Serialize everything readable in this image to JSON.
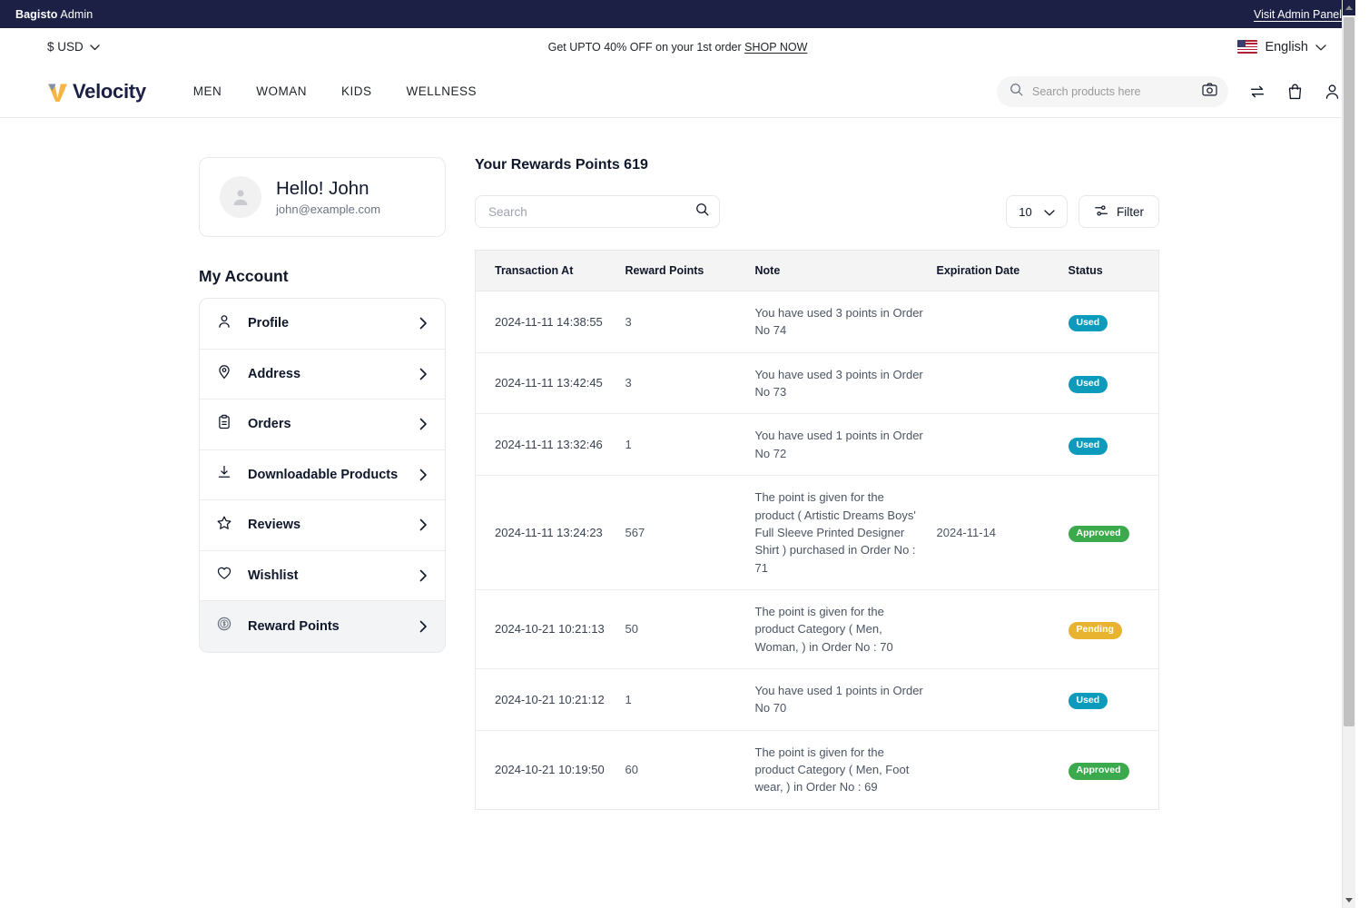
{
  "admin_bar": {
    "brand_bold": "Bagisto",
    "brand_rest": " Admin",
    "visit_link": "Visit Admin Panel"
  },
  "promo_bar": {
    "currency": "$ USD",
    "promo_text": "Get UPTO 40% OFF on your 1st order ",
    "promo_cta": "SHOP NOW",
    "language": "English"
  },
  "header": {
    "logo_text": "Velocity",
    "nav": [
      {
        "label": "MEN"
      },
      {
        "label": "WOMAN"
      },
      {
        "label": "KIDS"
      },
      {
        "label": "WELLNESS"
      }
    ],
    "search_placeholder": "Search products here",
    "search_value": ""
  },
  "sidebar": {
    "greeting": "Hello! John",
    "email": "john@example.com",
    "account_title": "My Account",
    "items": [
      {
        "label": "Profile",
        "icon": "user-icon",
        "active": false
      },
      {
        "label": "Address",
        "icon": "location-icon",
        "active": false
      },
      {
        "label": "Orders",
        "icon": "clipboard-icon",
        "active": false
      },
      {
        "label": "Downloadable Products",
        "icon": "download-icon",
        "active": false
      },
      {
        "label": "Reviews",
        "icon": "star-icon",
        "active": false
      },
      {
        "label": "Wishlist",
        "icon": "heart-icon",
        "active": false
      },
      {
        "label": "Reward Points",
        "icon": "coin-icon",
        "active": true
      }
    ]
  },
  "main": {
    "title": "Your Rewards Points 619",
    "rewards_points": 619,
    "search_placeholder": "Search",
    "search_value": "",
    "per_page": "10",
    "filter_label": "Filter",
    "columns": [
      "Transaction At",
      "Reward Points",
      "Note",
      "Expiration Date",
      "Status"
    ],
    "rows": [
      {
        "transaction_at": "2024-11-11 14:38:55",
        "reward_points": "3",
        "note": "You have used 3 points in Order No 74",
        "expiration_date": "",
        "status": "Used",
        "status_kind": "used"
      },
      {
        "transaction_at": "2024-11-11 13:42:45",
        "reward_points": "3",
        "note": "You have used 3 points in Order No 73",
        "expiration_date": "",
        "status": "Used",
        "status_kind": "used"
      },
      {
        "transaction_at": "2024-11-11 13:32:46",
        "reward_points": "1",
        "note": "You have used 1 points in Order No 72",
        "expiration_date": "",
        "status": "Used",
        "status_kind": "used"
      },
      {
        "transaction_at": "2024-11-11 13:24:23",
        "reward_points": "567",
        "note": "The point is given for the product ( Artistic Dreams Boys' Full Sleeve Printed Designer Shirt ) purchased in Order No : 71",
        "expiration_date": "2024-11-14",
        "status": "Approved",
        "status_kind": "approved"
      },
      {
        "transaction_at": "2024-10-21 10:21:13",
        "reward_points": "50",
        "note": "The point is given for the product Category ( Men, Woman, ) in Order No : 70",
        "expiration_date": "",
        "status": "Pending",
        "status_kind": "pending"
      },
      {
        "transaction_at": "2024-10-21 10:21:12",
        "reward_points": "1",
        "note": "You have used 1 points in Order No 70",
        "expiration_date": "",
        "status": "Used",
        "status_kind": "used"
      },
      {
        "transaction_at": "2024-10-21 10:19:50",
        "reward_points": "60",
        "note": "The point is given for the product Category ( Men, Foot wear, ) in Order No : 69",
        "expiration_date": "",
        "status": "Approved",
        "status_kind": "approved"
      }
    ]
  },
  "colors": {
    "admin_bar": "#1b2044",
    "brand_navy": "#1b2044",
    "brand_yellow": "#f5b544",
    "badge_used": "#0d9bbc",
    "badge_approved": "#3aaa4d",
    "badge_pending": "#e8b430"
  }
}
